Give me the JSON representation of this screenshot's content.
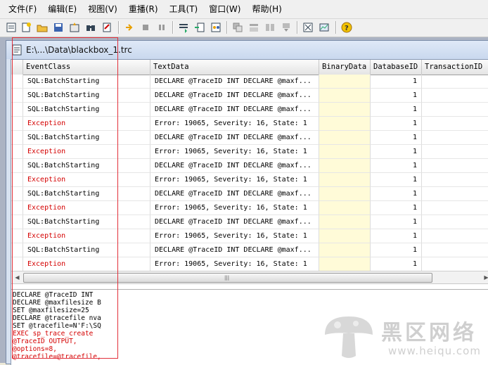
{
  "menu": [
    "文件(F)",
    "编辑(E)",
    "视图(V)",
    "重播(R)",
    "工具(T)",
    "窗口(W)",
    "帮助(H)"
  ],
  "toolbar_icons": [
    "new-trace-icon",
    "new-template-icon",
    "open-icon",
    "save-icon",
    "properties-icon",
    "find-icon",
    "clear-icon",
    "run-icon",
    "stop-icon",
    "pause-icon",
    "step-icon",
    "run-to-cursor-icon",
    "breakpoints-icon",
    "filter-icon",
    "group-icon",
    "columns-icon",
    "scroll-icon",
    "database-tuning-icon",
    "performance-monitor-icon",
    "help-icon"
  ],
  "window": {
    "title": "E:\\...\\Data\\blackbox_1.trc"
  },
  "columns": [
    "EventClass",
    "TextData",
    "BinaryData",
    "DatabaseID",
    "TransactionID"
  ],
  "rows": [
    {
      "event": "SQL:BatchStarting",
      "text": "DECLARE @TraceID INT  DECLARE @maxf...",
      "db": "1",
      "exception": false
    },
    {
      "event": "SQL:BatchStarting",
      "text": "DECLARE @TraceID INT  DECLARE @maxf...",
      "db": "1",
      "exception": false
    },
    {
      "event": "SQL:BatchStarting",
      "text": "DECLARE @TraceID INT  DECLARE @maxf...",
      "db": "1",
      "exception": false
    },
    {
      "event": "Exception",
      "text": "Error: 19065, Severity: 16, State: 1",
      "db": "1",
      "exception": true
    },
    {
      "event": "SQL:BatchStarting",
      "text": "DECLARE @TraceID INT  DECLARE @maxf...",
      "db": "1",
      "exception": false
    },
    {
      "event": "Exception",
      "text": "Error: 19065, Severity: 16, State: 1",
      "db": "1",
      "exception": true
    },
    {
      "event": "SQL:BatchStarting",
      "text": "DECLARE @TraceID INT  DECLARE @maxf...",
      "db": "1",
      "exception": false
    },
    {
      "event": "Exception",
      "text": "Error: 19065, Severity: 16, State: 1",
      "db": "1",
      "exception": true
    },
    {
      "event": "SQL:BatchStarting",
      "text": "DECLARE @TraceID INT  DECLARE @maxf...",
      "db": "1",
      "exception": false
    },
    {
      "event": "Exception",
      "text": "Error: 19065, Severity: 16, State: 1",
      "db": "1",
      "exception": true
    },
    {
      "event": "SQL:BatchStarting",
      "text": "DECLARE @TraceID INT  DECLARE @maxf...",
      "db": "1",
      "exception": false
    },
    {
      "event": "Exception",
      "text": "Error: 19065, Severity: 16, State: 1",
      "db": "1",
      "exception": true
    },
    {
      "event": "SQL:BatchStarting",
      "text": "DECLARE @TraceID INT  DECLARE @maxf...",
      "db": "1",
      "exception": false
    },
    {
      "event": "Exception",
      "text": "Error: 19065, Severity: 16, State: 1",
      "db": "1",
      "exception": true
    }
  ],
  "detail_lines": [
    {
      "text": "DECLARE @TraceID INT",
      "red": false
    },
    {
      "text": "DECLARE @maxfilesize B",
      "red": false
    },
    {
      "text": "SET @maxfilesize=25",
      "red": false
    },
    {
      "text": "DECLARE @tracefile nva",
      "red": false
    },
    {
      "text": "SET @tracefile=N'F:\\SQ",
      "red": false
    },
    {
      "text": "EXEC sp_trace_create",
      "red": true
    },
    {
      "text": "@TraceID OUTPUT,",
      "red": true
    },
    {
      "text": "@options=8,",
      "red": true
    },
    {
      "text": "@tracefile=@tracefile,",
      "red": true
    }
  ],
  "watermark": {
    "logo_text": "黑区网络",
    "url": "www.heiqu.com"
  },
  "colors": {
    "exception": "#d40000",
    "binary_bg": "#fffbd8",
    "highlight_box": "#e2303a"
  }
}
